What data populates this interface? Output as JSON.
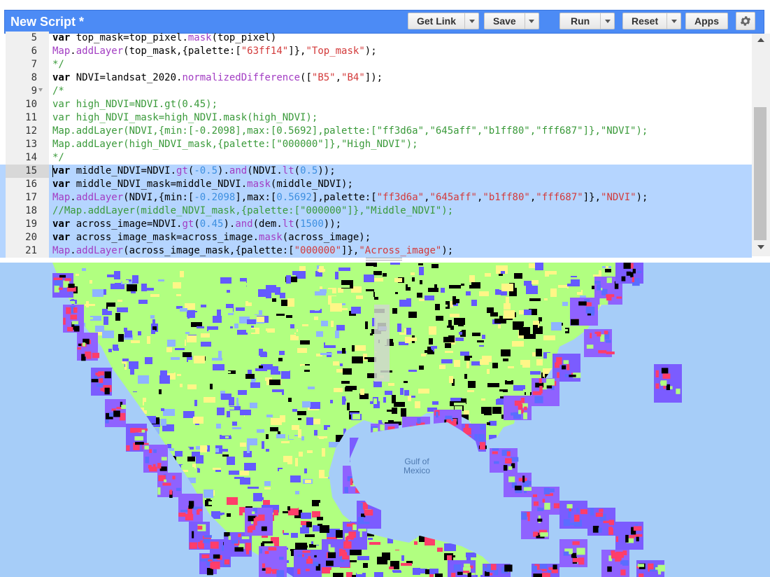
{
  "header": {
    "title": "New Script *",
    "buttons": {
      "get_link": "Get Link",
      "save": "Save",
      "run": "Run",
      "reset": "Reset",
      "apps": "Apps"
    },
    "settings_icon": "gear-icon"
  },
  "editor": {
    "current_line": 15,
    "lines": [
      {
        "num": "5",
        "text": "var top_mask=top_pixel.mask(top_pixel)"
      },
      {
        "num": "6",
        "text": "Map.addLayer(top_mask,{palette:[\"63ff14\"]},\"Top_mask\");"
      },
      {
        "num": "7",
        "text": "*/"
      },
      {
        "num": "8",
        "text": "var NDVI=landsat_2020.normalizedDifference([\"B5\",\"B4\"]);"
      },
      {
        "num": "9",
        "text": "/*"
      },
      {
        "num": "10",
        "text": "var high_NDVI=NDVI.gt(0.45);"
      },
      {
        "num": "11",
        "text": "var high_NDVI_mask=high_NDVI.mask(high_NDVI);"
      },
      {
        "num": "12",
        "text": "Map.addLayer(NDVI,{min:[-0.2098],max:[0.5692],palette:[\"ff3d6a\",\"645aff\",\"b1ff80\",\"fff687\"]},\"NDVI\");"
      },
      {
        "num": "13",
        "text": "Map.addLayer(high_NDVI_mask,{palette:[\"000000\"]},\"High_NDVI\");"
      },
      {
        "num": "14",
        "text": "*/"
      },
      {
        "num": "15",
        "text": "var middle_NDVI=NDVI.gt(-0.5).and(NDVI.lt(0.5));"
      },
      {
        "num": "16",
        "text": "var middle_NDVI_mask=middle_NDVI.mask(middle_NDVI);"
      },
      {
        "num": "17",
        "text": "Map.addLayer(NDVI,{min:[-0.2098],max:[0.5692],palette:[\"ff3d6a\",\"645aff\",\"b1ff80\",\"fff687\"]},\"NDVI\");"
      },
      {
        "num": "18",
        "text": "//Map.addLayer(middle_NDVI_mask,{palette:[\"000000\"]},\"Middle_NDVI\");"
      },
      {
        "num": "19",
        "text": "var across_image=NDVI.gt(0.45).and(dem.lt(1500));"
      },
      {
        "num": "20",
        "text": "var across_image_mask=across_image.mask(across_image);"
      },
      {
        "num": "21",
        "text": "Map.addLayer(across_image_mask,{palette:[\"000000\"]},\"Across_image\");"
      }
    ]
  },
  "map": {
    "gulf_label": "Gulf of\nMexico",
    "palette": [
      "#ff3d6a",
      "#645aff",
      "#b1ff80",
      "#fff687",
      "#000000"
    ],
    "water_color": "#a6cdf8"
  }
}
